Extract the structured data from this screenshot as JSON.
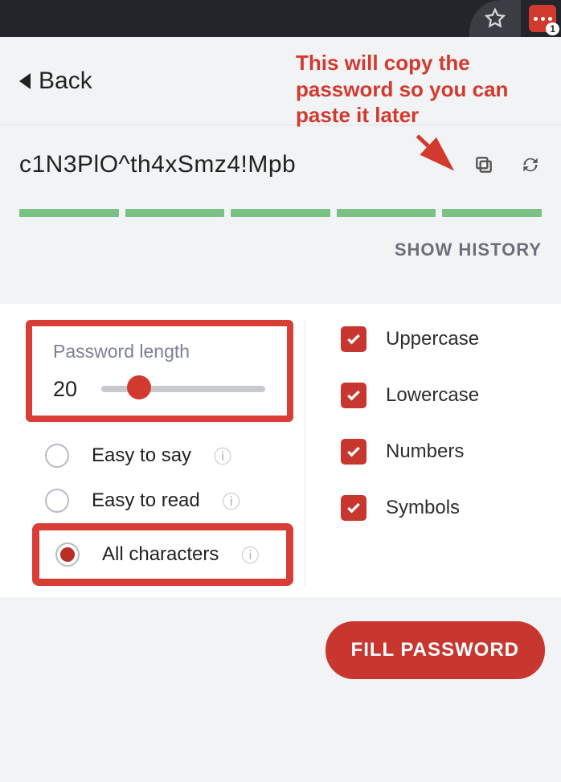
{
  "browser": {
    "ext_badge": "1"
  },
  "nav": {
    "back_label": "Back"
  },
  "annotation": {
    "copy_note_line1": "This will copy the",
    "copy_note_line2": "password so you can",
    "copy_note_line3": "paste it later"
  },
  "password": {
    "value": "c1N3PlO^th4xSmz4!Mpb",
    "show_history_label": "SHOW HISTORY",
    "strength_segments": 5
  },
  "settings": {
    "length_label": "Password length",
    "length_value": "20",
    "options": {
      "easy_say": "Easy to say",
      "easy_read": "Easy to read",
      "all_chars": "All characters"
    },
    "checks": {
      "uppercase": "Uppercase",
      "lowercase": "Lowercase",
      "numbers": "Numbers",
      "symbols": "Symbols"
    }
  },
  "footer": {
    "fill_label": "FILL PASSWORD"
  },
  "colors": {
    "brand_red": "#c8372f",
    "strength_green": "#7bc184"
  }
}
